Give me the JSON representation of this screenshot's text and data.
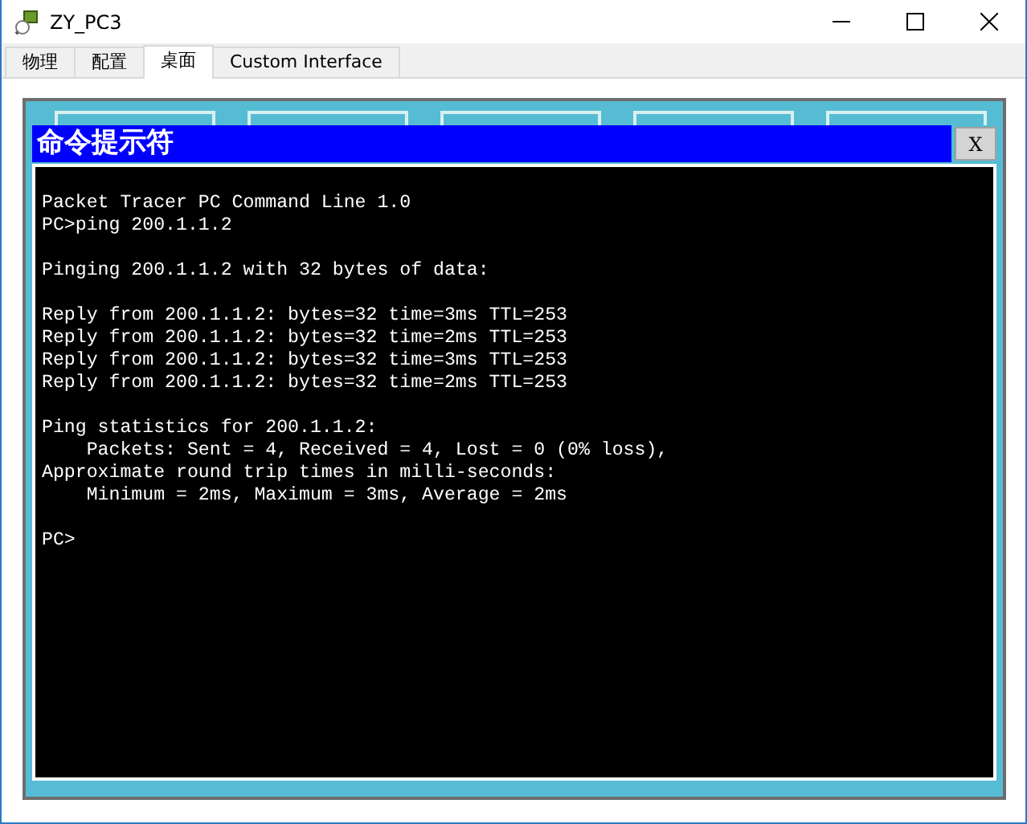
{
  "window": {
    "title": "ZY_PC3"
  },
  "tabs": [
    {
      "label": "物理",
      "selected": false
    },
    {
      "label": "配置",
      "selected": false
    },
    {
      "label": "桌面",
      "selected": true
    },
    {
      "label": "Custom Interface",
      "selected": false
    }
  ],
  "command_prompt": {
    "title": "命令提示符",
    "close_label": "X",
    "blocks": [
      [
        "Packet Tracer PC Command Line 1.0",
        "PC>ping 200.1.1.2"
      ],
      [
        "Pinging 200.1.1.2 with 32 bytes of data:"
      ],
      [
        "Reply from 200.1.1.2: bytes=32 time=3ms TTL=253",
        "Reply from 200.1.1.2: bytes=32 time=2ms TTL=253",
        "Reply from 200.1.1.2: bytes=32 time=3ms TTL=253",
        "Reply from 200.1.1.2: bytes=32 time=2ms TTL=253"
      ],
      [
        "Ping statistics for 200.1.1.2:",
        "    Packets: Sent = 4, Received = 4, Lost = 0 (0% loss),",
        "Approximate round trip times in milli-seconds:",
        "    Minimum = 2ms, Maximum = 3ms, Average = 2ms"
      ],
      [
        "PC>"
      ]
    ]
  }
}
